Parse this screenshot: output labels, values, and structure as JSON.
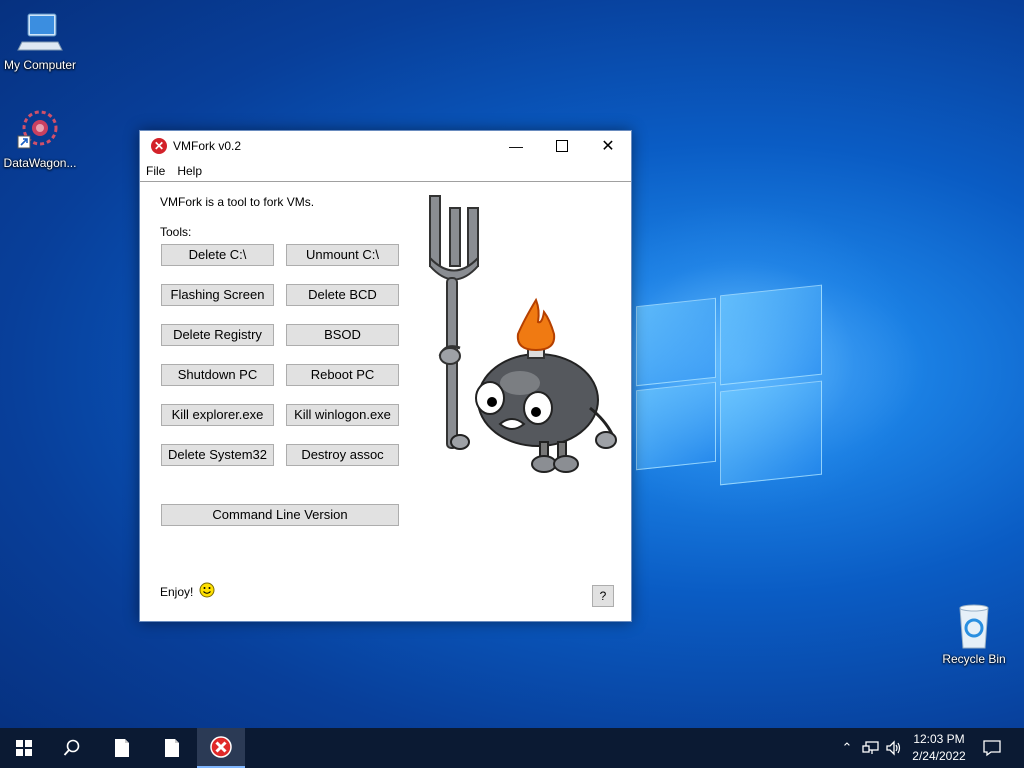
{
  "desktop": {
    "icons": [
      {
        "label": "My Computer",
        "icon": "computer-icon"
      },
      {
        "label": "DataWagon...",
        "icon": "app-shortcut-icon"
      },
      {
        "label": "Recycle Bin",
        "icon": "recycle-bin-icon"
      }
    ]
  },
  "window": {
    "title": "VMFork v0.2",
    "title_icon": "error-x-icon",
    "menu": [
      "File",
      "Help"
    ],
    "intro": "VMFork is a tool to fork VMs.",
    "tools_label": "Tools:",
    "buttons": [
      [
        "Delete C:\\",
        "Unmount C:\\"
      ],
      [
        "Flashing Screen",
        "Delete BCD"
      ],
      [
        "Delete Registry",
        "BSOD"
      ],
      [
        "Shutdown PC",
        "Reboot PC"
      ],
      [
        "Kill explorer.exe",
        "Kill winlogon.exe"
      ],
      [
        "Delete System32",
        "Destroy assoc"
      ]
    ],
    "command_line_button": "Command Line Version",
    "footer_text": "Enjoy!",
    "help_button": "?"
  },
  "taskbar": {
    "start_icon": "windows-start-icon",
    "search_icon": "search-icon",
    "pinned": [
      "file-icon",
      "file-icon",
      "vmfork-app-icon"
    ],
    "tray_icons": [
      "chevron-up-icon",
      "network-icon",
      "volume-icon"
    ],
    "time": "12:03 PM",
    "date": "2/24/2022",
    "notification_icon": "notification-icon"
  },
  "colors": {
    "desktop_blue": "#0a5cc4",
    "taskbar": "#0b1a33",
    "button_face": "#e1e1e1",
    "error_red": "#d3222a"
  }
}
